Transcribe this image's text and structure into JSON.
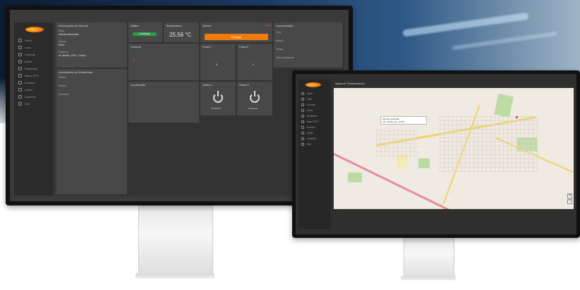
{
  "monitor1": {
    "sidebar": {
      "items": [
        {
          "label": "Geral",
          "icon": "grid-icon"
        },
        {
          "label": "Lista",
          "icon": "list-icon"
        },
        {
          "label": "Controle",
          "icon": "controller-icon"
        },
        {
          "label": "Alerta",
          "icon": "alert-icon"
        },
        {
          "label": "Relatórios",
          "icon": "report-icon"
        },
        {
          "label": "Mapa GPS",
          "icon": "map-icon"
        },
        {
          "label": "Eventos",
          "icon": "event-icon"
        },
        {
          "label": "Ações",
          "icon": "actions-icon"
        },
        {
          "label": "Usuários",
          "icon": "users-icon"
        },
        {
          "label": "Sair",
          "icon": "logout-icon"
        }
      ]
    },
    "cards": {
      "info": {
        "title": "Informações do Veículo",
        "rows": [
          "Placa",
          "Veículo Mercedes",
          "Modelo",
          "Ano",
          "2019",
          "Endereço",
          "Av. Brasil, 1234 - Centro"
        ]
      },
      "info2": {
        "title": "Informações do Rastreador",
        "rows": [
          "Modelo",
          "Número",
          "Operadora"
        ]
      },
      "status": {
        "title": "Status",
        "pill": "Conectado"
      },
      "temperature": {
        "title": "Temperatura",
        "value": "25,56 °C"
      },
      "sensor": {
        "title": "Sensor",
        "alert": "Alerta",
        "button": "Desligar"
      },
      "cards_mid": {
        "title": "Controle"
      },
      "trail": {
        "title": "Localização"
      },
      "door1": {
        "title": "Porta 1",
        "value": "0"
      },
      "door2": {
        "title": "Porta 2",
        "value": "0"
      },
      "out1": {
        "title": "Saída 1",
        "state": "Desligado"
      },
      "out2": {
        "title": "Saída 2",
        "state": "Desligado"
      },
      "right": {
        "title": "Comunicação",
        "rows": [
          "Sinal",
          "Bateria",
          "Tensão",
          "Última atualização"
        ]
      }
    }
  },
  "monitor2": {
    "title": "Mapa de Rastreamento",
    "sidebar": {
      "items": [
        "Geral",
        "Lista",
        "Controle",
        "Alerta",
        "Relatórios",
        "Mapa GPS",
        "Eventos",
        "Ações",
        "Usuários",
        "Sair"
      ]
    },
    "map": {
      "popup_lines": [
        "Veículo localizado",
        "Lat: -22.90 Lng: -47.06"
      ],
      "zoom_in": "+",
      "zoom_out": "−"
    }
  }
}
